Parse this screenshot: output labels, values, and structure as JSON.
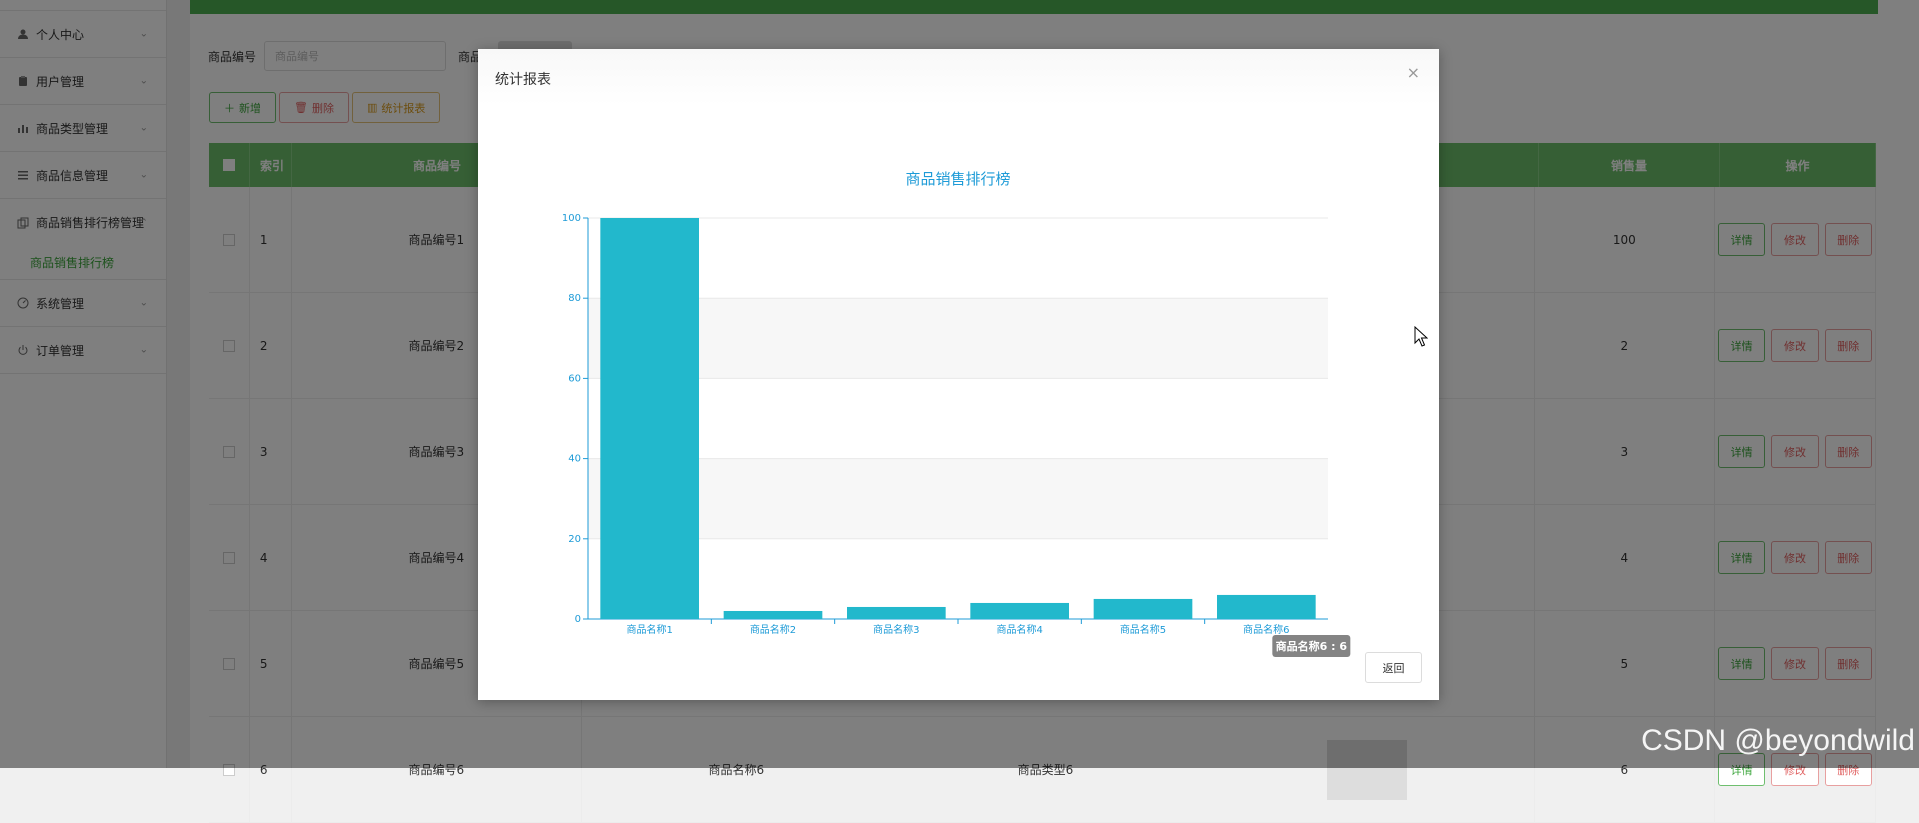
{
  "sidebar": {
    "items": [
      {
        "label": "个人中心",
        "icon": "user-icon"
      },
      {
        "label": "用户管理",
        "icon": "clipboard-icon"
      },
      {
        "label": "商品类型管理",
        "icon": "chart-icon"
      },
      {
        "label": "商品信息管理",
        "icon": "list-icon"
      },
      {
        "label": "商品销售排行榜管理",
        "icon": "copy-icon"
      },
      {
        "label": "系统管理",
        "icon": "gauge-icon"
      },
      {
        "label": "订单管理",
        "icon": "power-icon"
      }
    ],
    "sub_item": "商品销售排行榜"
  },
  "search": {
    "label": "商品编号",
    "placeholder": "商品编号",
    "label2": "商品"
  },
  "toolbar": {
    "add_label": "新增",
    "delete_label": "删除",
    "stat_label": "统计报表"
  },
  "table": {
    "headers": {
      "index": "索引",
      "product_no": "商品编号",
      "sales": "销售量",
      "operation": "操作"
    },
    "rows": [
      {
        "index": "1",
        "product_no": "商品编号1",
        "sales": "100"
      },
      {
        "index": "2",
        "product_no": "商品编号2",
        "sales": "2"
      },
      {
        "index": "3",
        "product_no": "商品编号3",
        "sales": "3"
      },
      {
        "index": "4",
        "product_no": "商品编号4",
        "sales": "4"
      },
      {
        "index": "5",
        "product_no": "商品编号5",
        "sales": "5"
      },
      {
        "index": "6",
        "product_no": "商品编号6",
        "sales": "6",
        "name": "商品名称6",
        "type": "商品类型6"
      }
    ],
    "op_detail": "详情",
    "op_edit": "修改",
    "op_delete": "删除"
  },
  "dialog": {
    "title": "统计报表",
    "close": "×",
    "return_label": "返回"
  },
  "chart_data": {
    "type": "bar",
    "title": "商品销售排行榜",
    "categories": [
      "商品名称1",
      "商品名称2",
      "商品名称3",
      "商品名称4",
      "商品名称5",
      "商品名称6"
    ],
    "values": [
      100,
      2,
      3,
      4,
      5,
      6
    ],
    "ylim": [
      0,
      100
    ],
    "yticks": [
      0,
      20,
      40,
      60,
      80,
      100
    ],
    "grid": "horizontal-bands",
    "bar_color": "#22b8cc",
    "axis_color": "#1e9bd7",
    "tooltip": "商品名称6 : 6"
  },
  "watermark": "CSDN @beyondwild",
  "colors": {
    "accent": "#4caf50",
    "danger": "#e06060",
    "warning": "#d99a1c"
  }
}
